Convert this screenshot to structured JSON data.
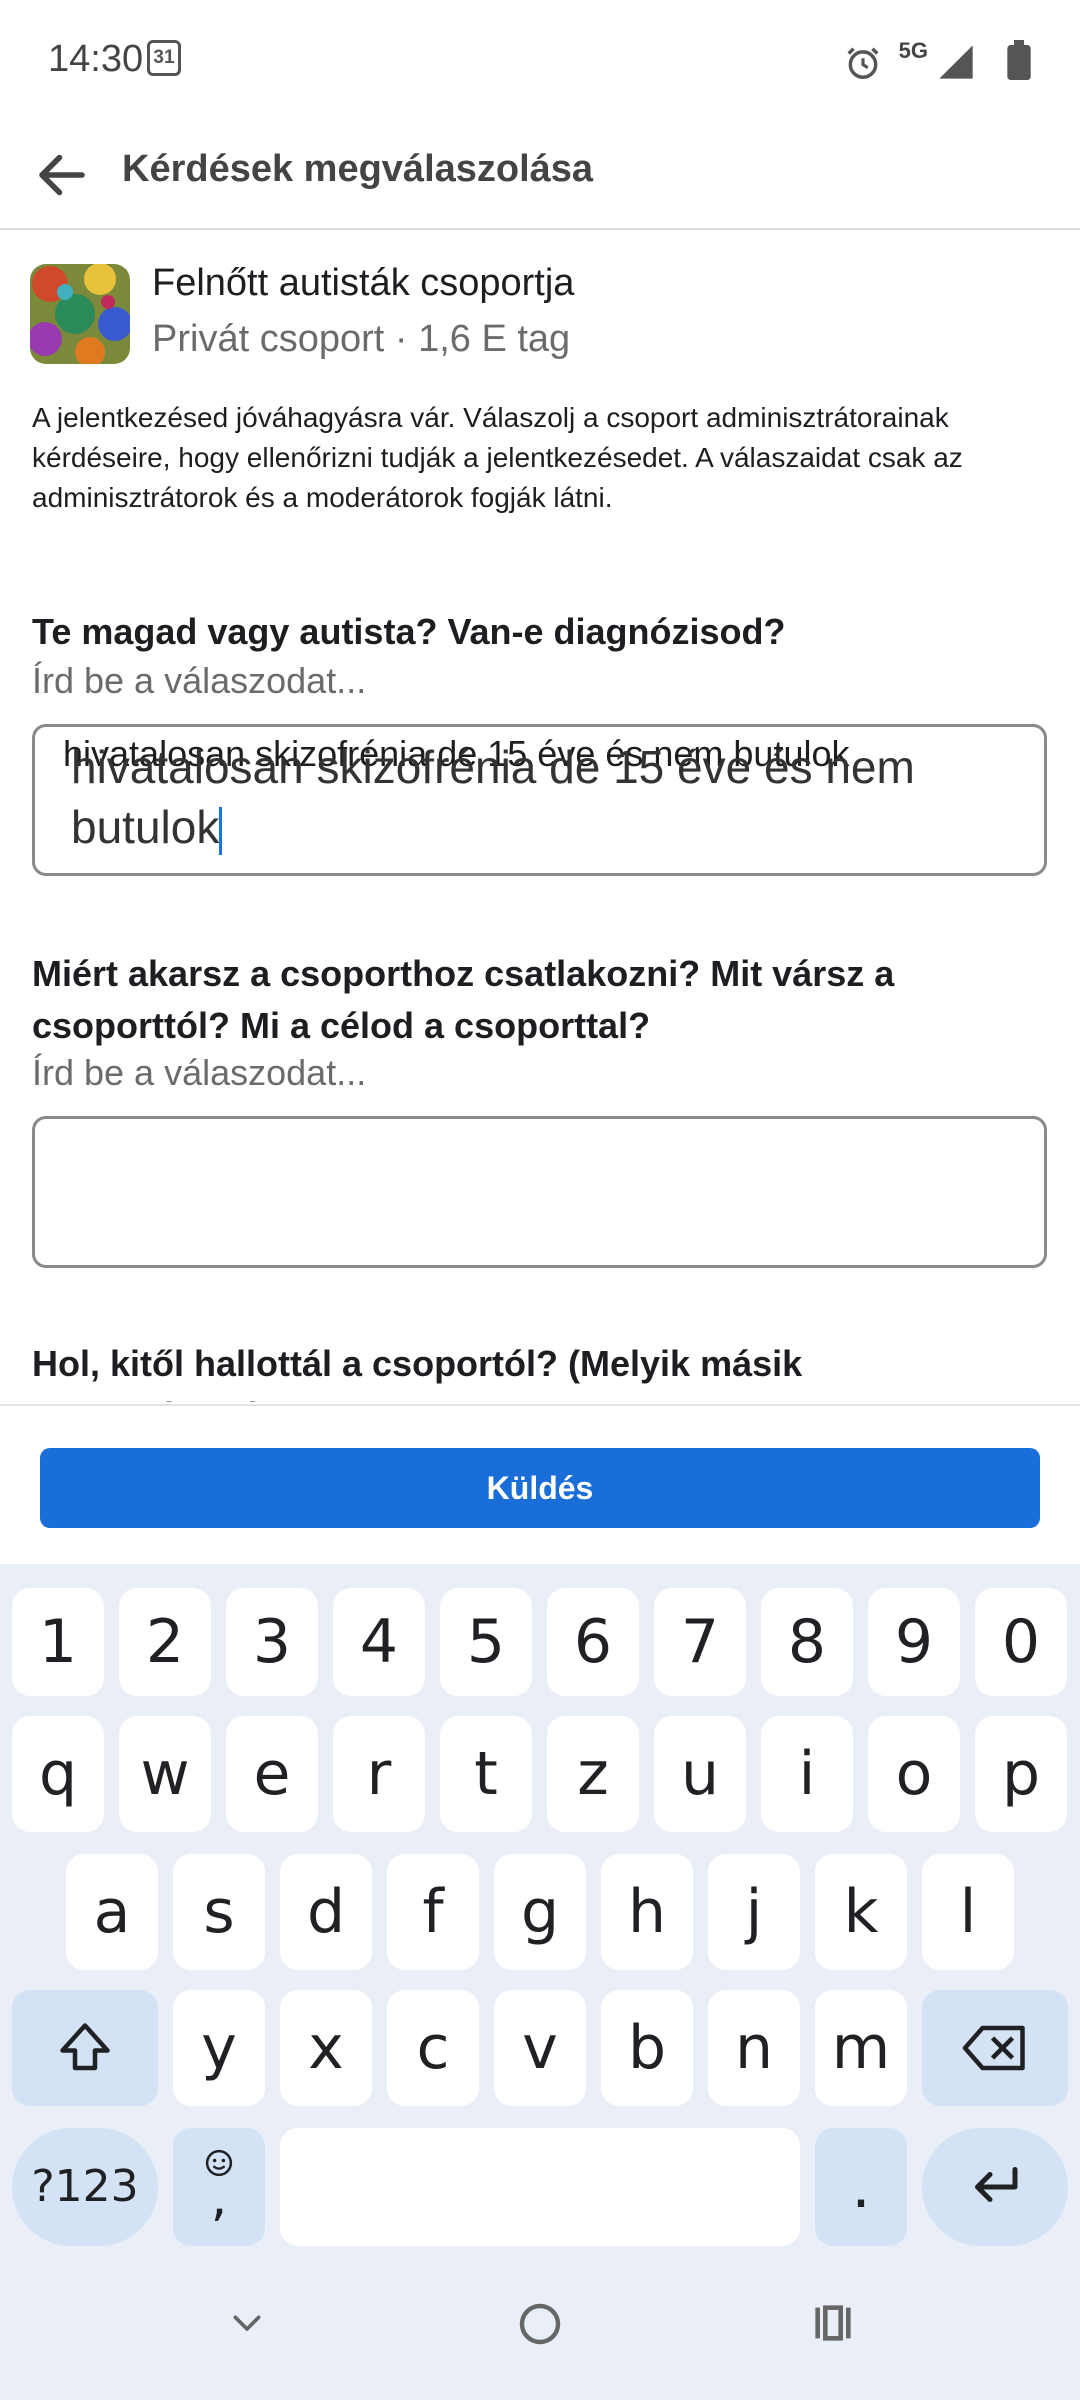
{
  "status": {
    "time": "14:30",
    "calendar_day": "31",
    "network": "5G"
  },
  "header": {
    "title": "Kérdések megválaszolása"
  },
  "group": {
    "name": "Felnőtt autisták csoportja",
    "meta": "Privát csoport · 1,6 E tag"
  },
  "notice": "A jelentkezésed jóváhagyásra vár. Válaszolj a csoport adminisztrátorainak kérdéseire, hogy ellenőrizni tudják a jelentkezésedet. A válaszaidat csak az adminisztrátorok és a moderátorok fogják látni.",
  "questions": [
    {
      "text": "Te magad vagy autista? Van-e diagnózisod?",
      "placeholder": "Írd be a válaszodat...",
      "overlay": "hivatalosan skizofrénia de 15 éve és nem butulok",
      "value": "hivatalosan skizofrénia de 15 éve és nem butulok"
    },
    {
      "text": "Miért akarsz a csoporthoz csatlakozni? Mit vársz a csoporttól? Mi a célod a csoporttal?",
      "placeholder": "Írd be a válaszodat...",
      "value": ""
    },
    {
      "text": "Hol, kitől hallottál a csoportól? (Melyik másik csoportban?)"
    }
  ],
  "send_label": "Küldés",
  "keyboard": {
    "row_numbers": [
      "1",
      "2",
      "3",
      "4",
      "5",
      "6",
      "7",
      "8",
      "9",
      "0"
    ],
    "row1": [
      "q",
      "w",
      "e",
      "r",
      "t",
      "z",
      "u",
      "i",
      "o",
      "p"
    ],
    "row2": [
      "a",
      "s",
      "d",
      "f",
      "g",
      "h",
      "j",
      "k",
      "l"
    ],
    "row3": [
      "y",
      "x",
      "c",
      "v",
      "b",
      "n",
      "m"
    ],
    "symbols_label": "?123",
    "comma": ",",
    "period": "."
  }
}
